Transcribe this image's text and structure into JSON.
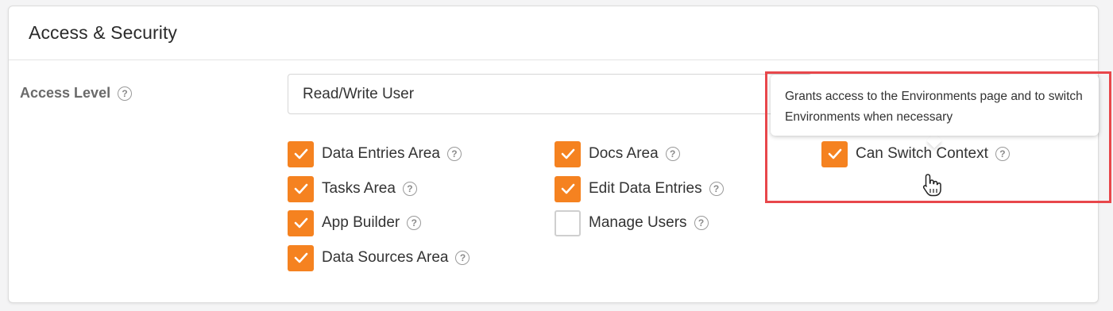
{
  "card": {
    "title": "Access & Security"
  },
  "access_level": {
    "label": "Access Level",
    "help": "?",
    "selected_value": "Read/Write User"
  },
  "checkboxes": [
    {
      "label": "Data Entries Area",
      "checked": true
    },
    {
      "label": "Tasks Area",
      "checked": true
    },
    {
      "label": "App Builder",
      "checked": true
    },
    {
      "label": "Data Sources Area",
      "checked": true
    },
    {
      "label": "Docs Area",
      "checked": true
    },
    {
      "label": "Edit Data Entries",
      "checked": true
    },
    {
      "label": "Manage Users",
      "checked": false
    },
    {
      "label": "Can Switch Context",
      "checked": true
    }
  ],
  "tooltip": {
    "text": "Grants access to the Environments page and to switch Environments when necessary"
  },
  "colors": {
    "accent": "#f58220",
    "highlight": "#e8474b"
  },
  "icons": {
    "help": "help-circle-icon",
    "check": "check-icon",
    "cursor": "hand-pointer-icon"
  }
}
